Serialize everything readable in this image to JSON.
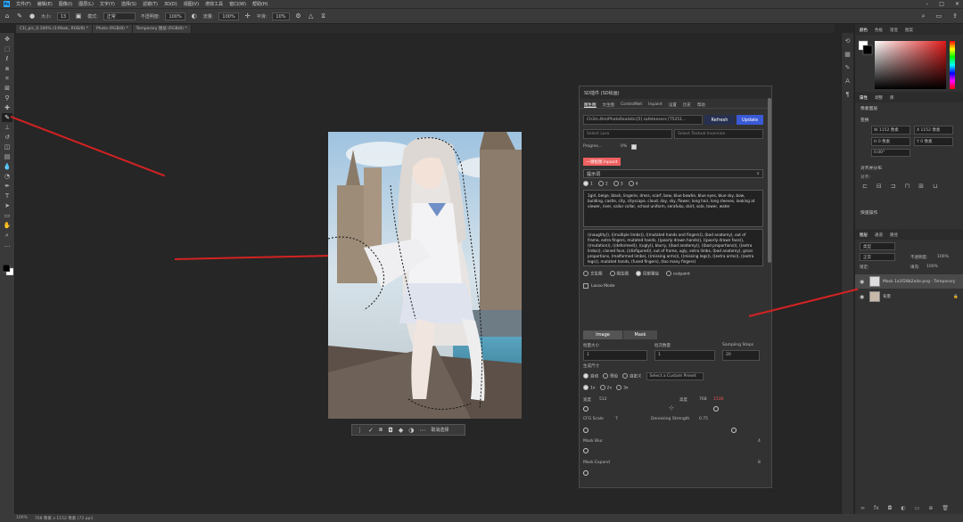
{
  "app": {
    "logo": "Ps"
  },
  "menubar": {
    "items": [
      "文件(F)",
      "编辑(E)",
      "图像(I)",
      "图层(L)",
      "文字(Y)",
      "选择(S)",
      "滤镜(T)",
      "3D(D)",
      "视图(V)",
      "增效工具",
      "窗口(W)",
      "帮助(H)"
    ]
  },
  "optionsbar": {
    "size_label": "大小:",
    "size_value": "13",
    "mode_label": "模式:",
    "mode_value": "正常",
    "opacity_label": "不透明度:",
    "opacity_value": "100%",
    "flow_label": "流量:",
    "flow_value": "100%",
    "smooth_label": "平滑:",
    "smooth_value": "10%"
  },
  "tabs": [
    "C1l_pic_0.100% (3:Mask, RGB/8) *",
    "Photo (RGB/8) *",
    "Temporary 图层 (RGB/8) *"
  ],
  "contextbar": {
    "label": "取消选择"
  },
  "statusbar": {
    "zoom": "100%",
    "info": "768 像素 x 1152 像素 (72 ppi)"
  },
  "sdpanel": {
    "title": "SD插件 (SD绘画)",
    "tabs": [
      "图生图",
      "文生图",
      "ControlNet",
      "Inpaint",
      "设置",
      "历史",
      "帮助"
    ],
    "model": "Ch3/s.4lm/PhotoRealistic[5] safetensors [T5251...",
    "refresh": "Refresh",
    "update": "Update",
    "select_lora": "Select Lora",
    "select_ti": "Select Textual Inversion",
    "progress_label": "Progres...",
    "progress_val": "0%",
    "red_button": "一键抠图 Inpaint",
    "prompt_label": "提示词",
    "prompt_tabs": [
      "1",
      "2",
      "3",
      "4"
    ],
    "prompt_text": "1girl, beige, black, lingerie, dress, scarf, bow, blue bowtie, blue eyes, blue sky, bow, building, castle, city, cityscape, cloud, day, sky, flower, long hair, long sleeves, looking at viewer, river, sailor collar, school uniform, serafuku, skirt, solo, tower, water",
    "neg_text": "((naughty)), ((multiple limbs)), ((mutated hands and fingers)), (bad anatomy), out of frame, extra fingers, mutated hands, ((poorly drawn hands)), ((poorly drawn face)), ((mutation)), ((deformed)), ((ugly)), blurry, ((bad anatomy)), ((bad proportions)), ((extra limbs)), cloned face, ((disfigured)), out of frame, ugly, extra limbs, (bad anatomy), gross proportions, (malformed limbs), ((missing arms)), ((missing legs)), ((extra arms)), ((extra legs)), mutated hands, (fused fingers), (too many fingers)",
    "mode_options": [
      "文生图",
      "图生图",
      "局部重绘",
      "outpaint"
    ],
    "lasso": "Lasso Mode",
    "image_tab": "Image",
    "mask_tab": "Mask",
    "batch_label": "批量大小",
    "batch_val": "1",
    "count_label": "批次数量",
    "count_val": "1",
    "steps_label": "Sampling Steps",
    "steps_val": "20",
    "size_label": "生成尺寸",
    "size_options": [
      "自动",
      "预设",
      "自定义"
    ],
    "preset": "Select a Custom Preset",
    "ratio_options": [
      "1x",
      "2x",
      "3x"
    ],
    "width_label": "宽度",
    "width_val": "512",
    "height_label": "高度",
    "height_val": "768",
    "height_max": "1536",
    "cfg_label": "CFG Scale",
    "cfg_val": "7",
    "denoise_label": "Denoising Strength",
    "denoise_val": "0.75",
    "mask_blur": "Mask Blur",
    "mask_blur_val": "4",
    "mask_expand": "Mask Expand",
    "mask_expand_val": "8"
  },
  "rightpanel": {
    "top_tabs": [
      "颜色",
      "色板",
      "渐变",
      "图案"
    ],
    "prop_tabs": [
      "属性",
      "调整",
      "库"
    ],
    "prop_title": "像素图层",
    "transform": "变换",
    "w_label": "W",
    "w_val": "1152 像素",
    "h_label": "H",
    "h_val": "0 像素",
    "x_label": "X",
    "x_val": "1152 像素",
    "y_label": "Y",
    "y_val": "0 像素",
    "angle": "0.00°",
    "align": "对齐并分布",
    "align2": "对齐:",
    "quick": "快速操作",
    "layer_tabs": [
      "图层",
      "通道",
      "路径"
    ],
    "layer_search": "类型",
    "blend_mode": "正常",
    "opacity_label": "不透明度:",
    "opacity_val": "100%",
    "lock_label": "锁定:",
    "fill_label": "填充:",
    "fill_val": "100%",
    "layers": [
      {
        "name": "Mask 1a3f28b2a4e.png - Temporary"
      },
      {
        "name": "背景"
      }
    ]
  }
}
